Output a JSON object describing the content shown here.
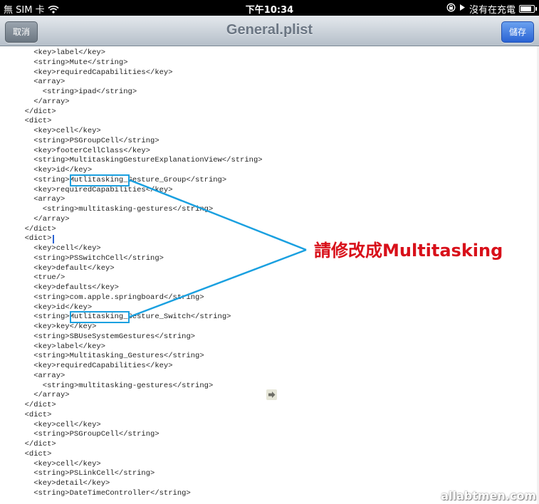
{
  "status_bar": {
    "carrier": "無 SIM 卡",
    "time": "下午10:34",
    "charging": "沒有在充電",
    "icons": [
      "wifi-icon",
      "lock-rotation-icon",
      "play-icon",
      "battery-icon"
    ],
    "battery_level": 0.85
  },
  "nav": {
    "title": "General.plist",
    "cancel_label": "取消",
    "save_label": "儲存"
  },
  "code_lines": [
    "    <key>label</key>",
    "    <string>Mute</string>",
    "    <key>requiredCapabilities</key>",
    "    <array>",
    "      <string>ipad</string>",
    "    </array>",
    "  </dict>",
    "  <dict>",
    "    <key>cell</key>",
    "    <string>PSGroupCell</string>",
    "    <key>footerCellClass</key>",
    "    <string>MultitaskingGestureExplanationView</string>",
    "    <key>id</key>",
    "    <string>Mutlitasking_Gesture_Group</string>",
    "    <key>requiredCapabilities</key>",
    "    <array>",
    "      <string>multitasking-gestures</string>",
    "    </array>",
    "  </dict>",
    "  <dict>",
    "    <key>cell</key>",
    "    <string>PSSwitchCell</string>",
    "    <key>default</key>",
    "    <true/>",
    "    <key>defaults</key>",
    "    <string>com.apple.springboard</string>",
    "    <key>id</key>",
    "    <string>Mutlitasking_Gesture_Switch</string>",
    "    <key>key</key>",
    "    <string>SBUseSystemGestures</string>",
    "    <key>label</key>",
    "    <string>Multitasking_Gestures</string>",
    "    <key>requiredCapabilities</key>",
    "    <array>",
    "      <string>multitasking-gestures</string>",
    "    </array>",
    "  </dict>",
    "  <dict>",
    "    <key>cell</key>",
    "    <string>PSGroupCell</string>",
    "  </dict>",
    "  <dict>",
    "    <key>cell</key>",
    "    <string>PSLinkCell</string>",
    "    <key>detail</key>",
    "    <string>DateTimeController</string>"
  ],
  "annotation": {
    "text": "請修改成Multitasking",
    "color": "#d8101a",
    "box_color": "#1aa0e0"
  },
  "watermark": "allabtmen.com"
}
